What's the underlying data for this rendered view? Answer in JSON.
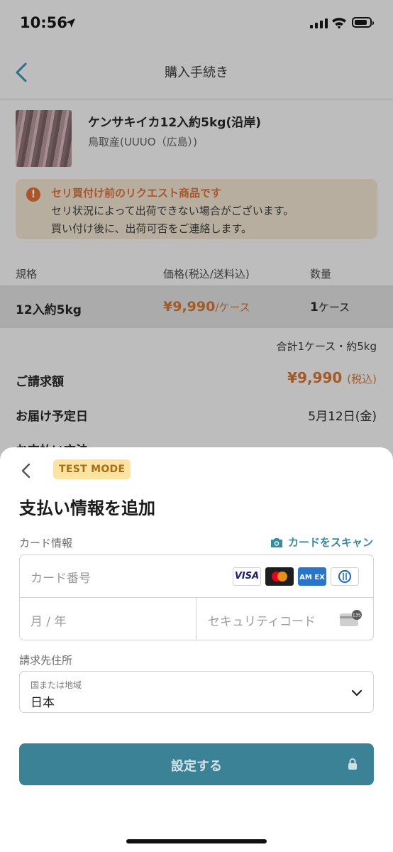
{
  "status_bar": {
    "time": "10:56"
  },
  "header": {
    "title": "購入手続き"
  },
  "product": {
    "name": "ケンサキイカ12入約5kg(沿岸)",
    "origin": "鳥取産(UUUO（広島）)"
  },
  "notice": {
    "title": "セリ買付け前のリクエスト商品です",
    "line1": "セリ状況によって出荷できない場合がございます。",
    "line2": "買い付け後に、出荷可否をご連絡します。"
  },
  "table": {
    "headers": [
      "規格",
      "価格(税込/送料込)",
      "数量"
    ],
    "spec": "12入約5kg",
    "price": "¥9,990",
    "price_unit": "/ケース",
    "qty": "1",
    "qty_unit": "ケース"
  },
  "summary": {
    "total_note": "合計1ケース・約5kg",
    "billing_label": "ご請求額",
    "billing_amount": "¥9,990",
    "billing_tax": "(税込)",
    "delivery_label": "お届け予定日",
    "delivery_date": "5月12日(金)",
    "payment_label": "お支払い方法"
  },
  "sheet": {
    "badge": "TEST MODE",
    "title": "支払い情報を追加",
    "card_section_label": "カード情報",
    "scan_label": "カードをスキャン",
    "card_number_placeholder": "カード番号",
    "expiry_placeholder": "月 / 年",
    "cvc_placeholder": "セキュリティコード",
    "cvc_badge": "135",
    "billing_section_label": "請求先住所",
    "country_caption": "国または地域",
    "country_value": "日本",
    "submit_label": "設定する",
    "card_brands": [
      "VISA",
      "Mastercard",
      "AMEX",
      "Diners"
    ]
  },
  "colors": {
    "accent": "#3c8296",
    "price": "#a45a28",
    "badge_bg": "#fde3a1"
  }
}
